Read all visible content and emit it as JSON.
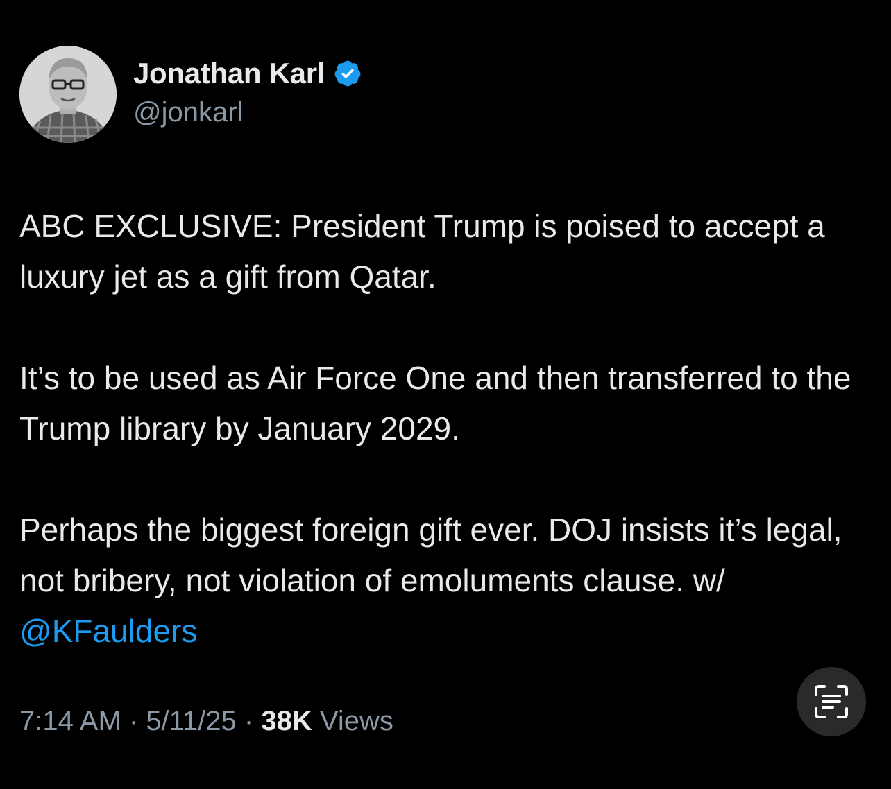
{
  "author": {
    "display_name": "Jonathan Karl",
    "handle": "@jonkarl",
    "verified": true
  },
  "tweet": {
    "paragraphs": [
      "ABC EXCLUSIVE: President Trump is poised to accept a luxury jet as a gift from Qatar.",
      "It’s to be used as Air Force One and then transferred to the Trump library by January 2029."
    ],
    "last_paragraph_text": "Perhaps the biggest foreign gift ever. DOJ insists it’s legal, not bribery, not violation of emoluments clause. w/ ",
    "mention": "@KFaulders"
  },
  "meta": {
    "time": "7:14 AM",
    "separator": " · ",
    "date": "5/11/25",
    "views_count": "38K",
    "views_label": " Views"
  },
  "icons": {
    "verified": "verified-badge-icon",
    "text_scan": "text-scan-icon"
  },
  "colors": {
    "background": "#000000",
    "text_primary": "#e7e9ea",
    "text_secondary": "#8b98a5",
    "link": "#1d9bf0",
    "verified": "#1d9bf0"
  }
}
